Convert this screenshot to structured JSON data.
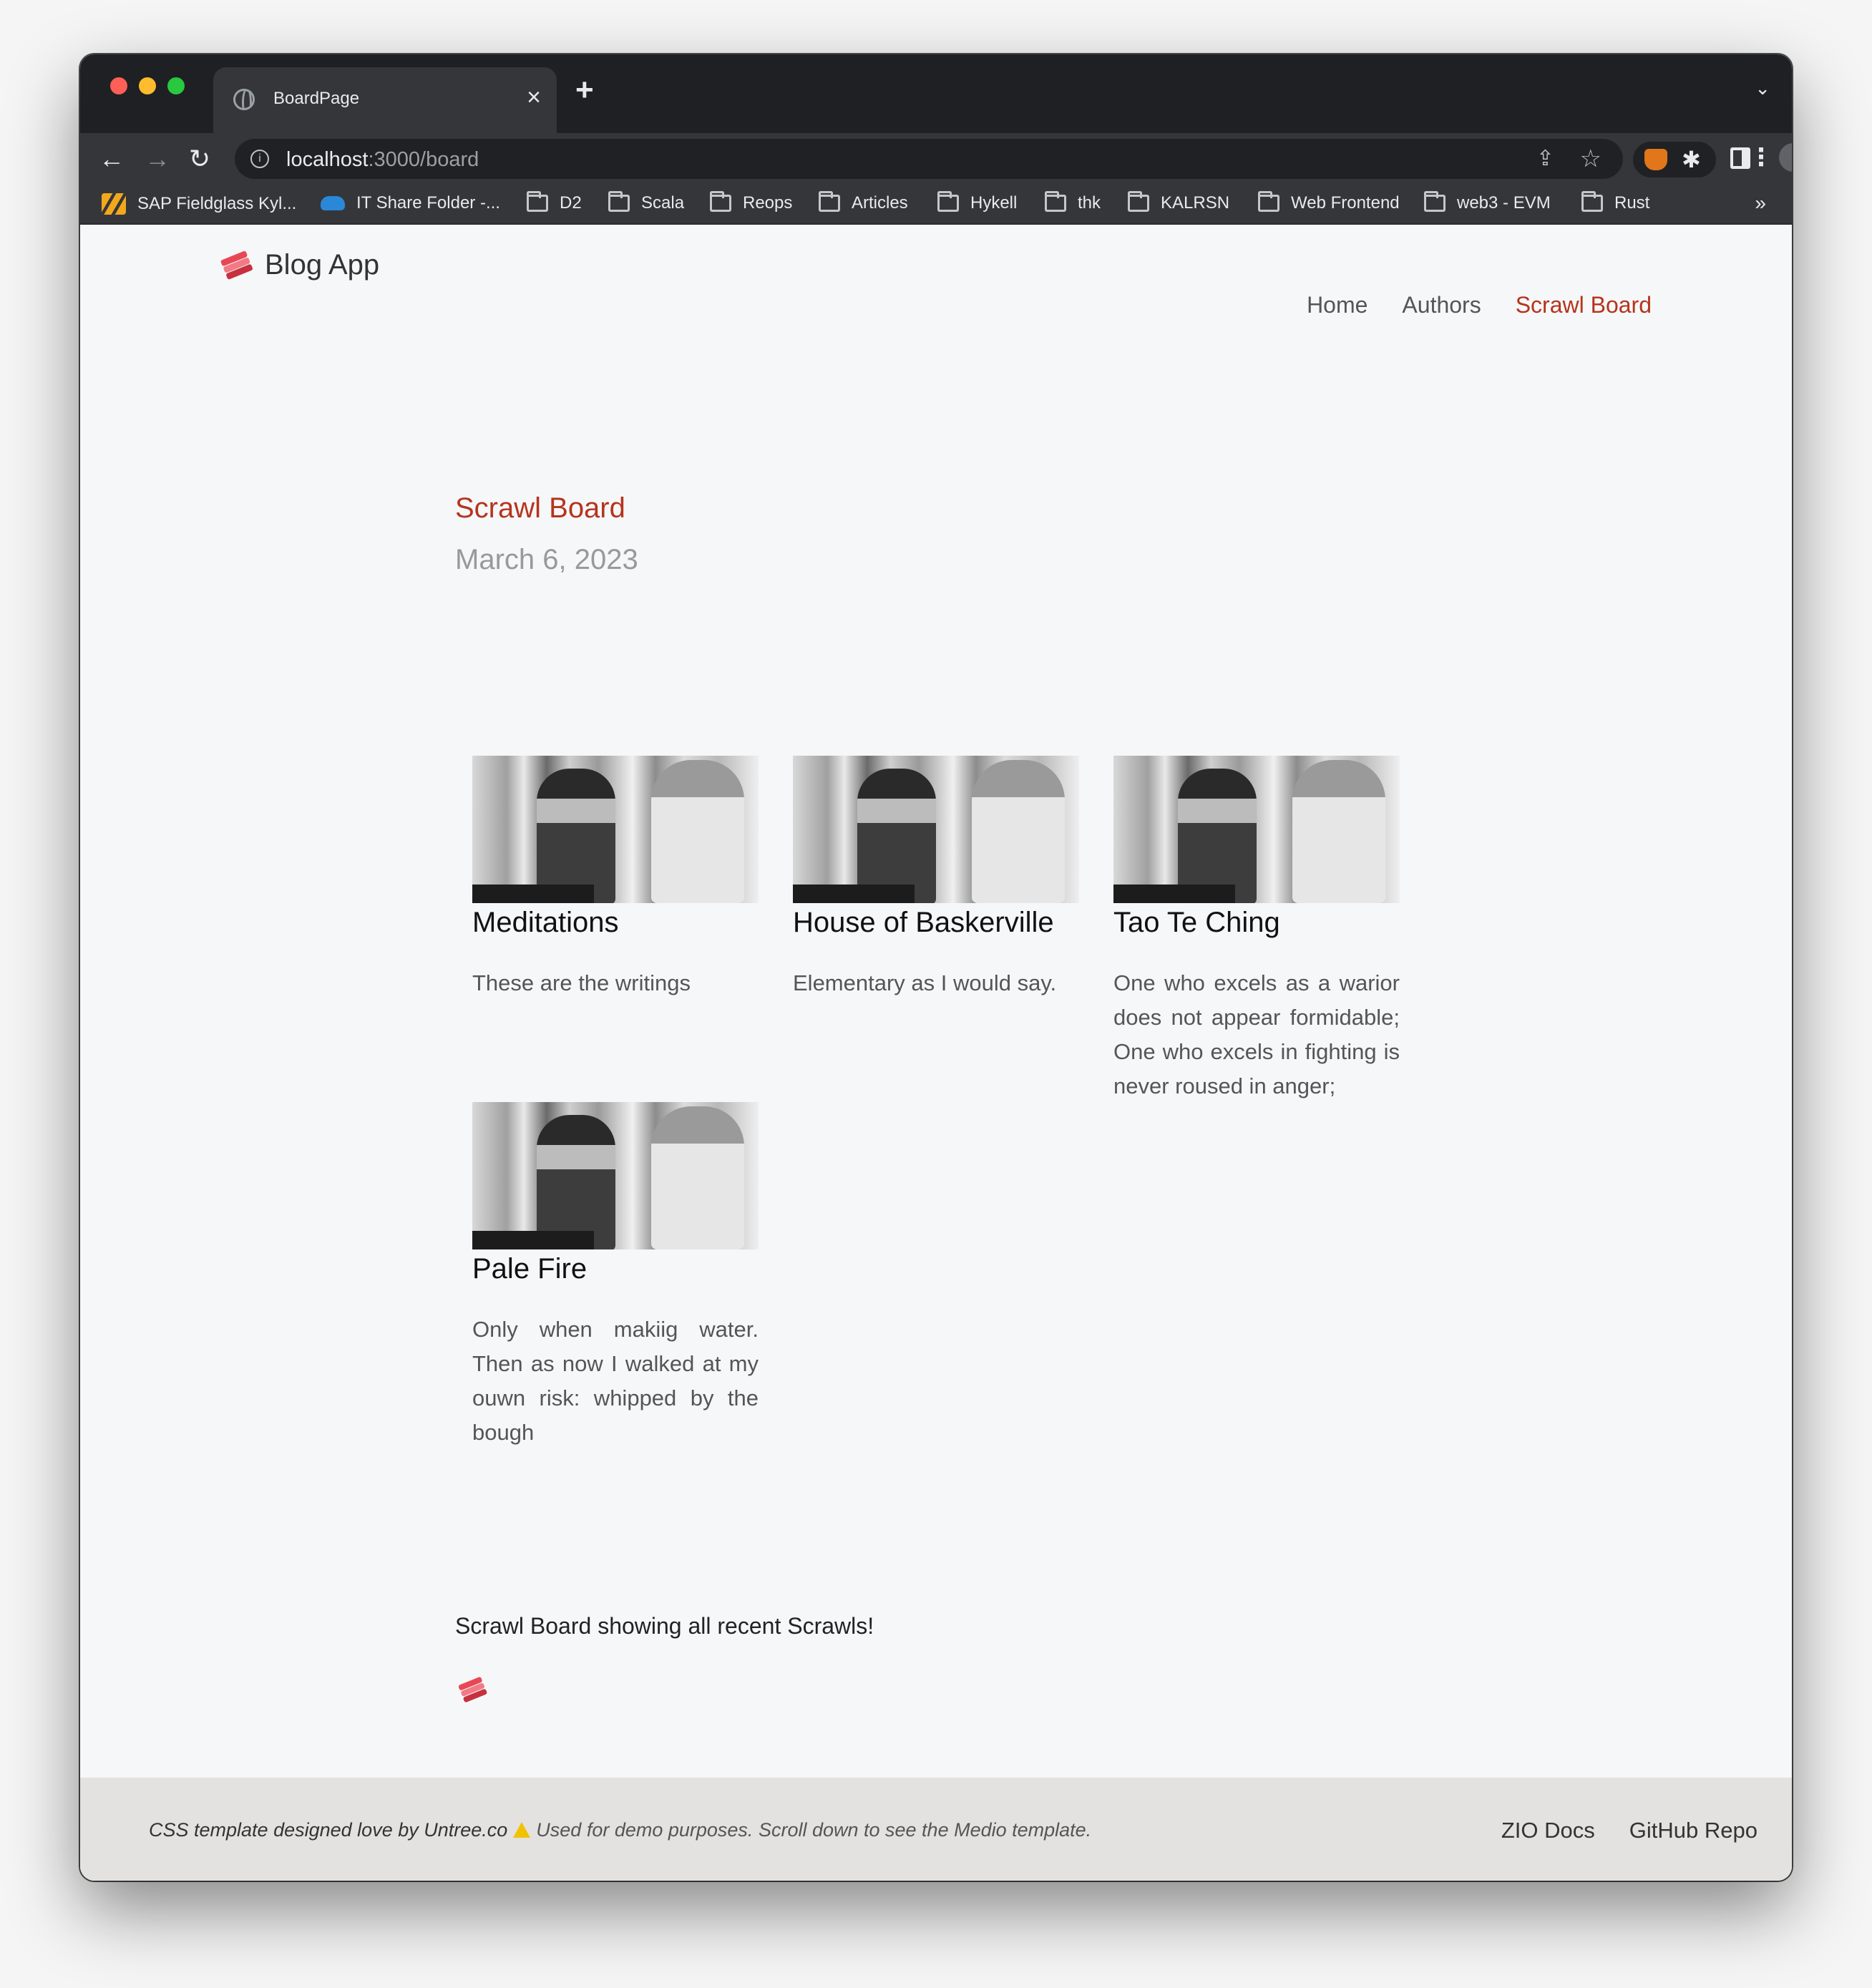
{
  "browser": {
    "tab_title": "BoardPage",
    "url_host": "localhost",
    "url_path": ":3000/board",
    "bookmarks": [
      {
        "label": "SAP Fieldglass Kyl...",
        "icon": "sap-icon"
      },
      {
        "label": "IT Share Folder -...",
        "icon": "onedrive-icon"
      },
      {
        "label": "D2",
        "icon": "folder-icon"
      },
      {
        "label": "Scala",
        "icon": "folder-icon"
      },
      {
        "label": "Reops",
        "icon": "folder-icon"
      },
      {
        "label": "Articles",
        "icon": "folder-icon"
      },
      {
        "label": "Hykell",
        "icon": "folder-icon"
      },
      {
        "label": "thk",
        "icon": "folder-icon"
      },
      {
        "label": "KALRSN",
        "icon": "folder-icon"
      },
      {
        "label": "Web Frontend",
        "icon": "folder-icon"
      },
      {
        "label": "web3 - EVM",
        "icon": "folder-icon"
      },
      {
        "label": "Rust",
        "icon": "folder-icon"
      }
    ],
    "bookmarks_more": "»"
  },
  "header": {
    "logo_text": "Blog App",
    "nav": [
      {
        "label": "Home",
        "active": false
      },
      {
        "label": "Authors",
        "active": false
      },
      {
        "label": "Scrawl Board",
        "active": true
      }
    ]
  },
  "board": {
    "title": "Scrawl Board",
    "date": "March 6, 2023",
    "cards": [
      {
        "title": "Meditations",
        "text": "These are the writings"
      },
      {
        "title": "House of Baskerville",
        "text": "Elementary as I would say."
      },
      {
        "title": "Tao Te Ching",
        "text": "One who excels as a warior does not appear formidable; One who excels in fighting is never roused in anger;"
      },
      {
        "title": "Pale Fire",
        "text": "Only when makiig water. Then as now I walked at my ouwn risk: whipped by the bough"
      }
    ],
    "summary": "Scrawl Board showing all recent Scrawls!"
  },
  "footer": {
    "credit": "CSS template designed love by Untree.co",
    "note": "Used for demo purposes. Scroll down to see the Medio template.",
    "links": [
      "ZIO Docs",
      "GitHub Repo"
    ]
  },
  "colors": {
    "accent": "#b5341c",
    "page_bg": "#f6f7f9",
    "footer_bg": "#e3e2e0",
    "chrome_dark": "#1f2023"
  }
}
